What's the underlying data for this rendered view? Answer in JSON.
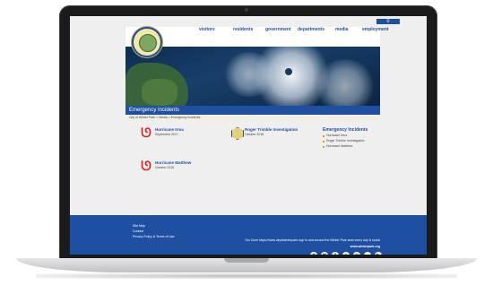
{
  "nav": {
    "search": "⚲",
    "items": [
      "visitors",
      "residents",
      "government",
      "departments",
      "media",
      "employment"
    ]
  },
  "hero": {
    "title": "Emergency Incidents"
  },
  "breadcrumb": {
    "text": "City of Winter Park > Media > Emergency Incidents"
  },
  "incidents": [
    {
      "title": "Hurricane Irma",
      "date": "September 2017"
    },
    {
      "title": "Roger Trimble Investigation",
      "date": "October 2016"
    },
    {
      "title": "Hurricane Matthew",
      "date": "October 2016"
    }
  ],
  "sidebar": {
    "title": "Emergency Incidents",
    "links": [
      "Hurricane Irma",
      "Roger Trimble Investigation",
      "Hurricane Matthew"
    ]
  },
  "footer": {
    "links": [
      "Site Map",
      "Contact",
      "Privacy Policy & Terms of Use"
    ],
    "zone_text": "Our Zone https://www.cityofwinterpark.org/ in and around the Winter Park area every day & social",
    "url": "www.winterpark.org",
    "social_icons": [
      "rss-icon",
      "email-icon",
      "facebook-icon",
      "twitter-icon",
      "instagram-icon",
      "flickr-icon",
      "youtube-icon"
    ]
  },
  "colors": {
    "brand_blue": "#1f4fa0",
    "hurricane_red": "#d82323"
  }
}
